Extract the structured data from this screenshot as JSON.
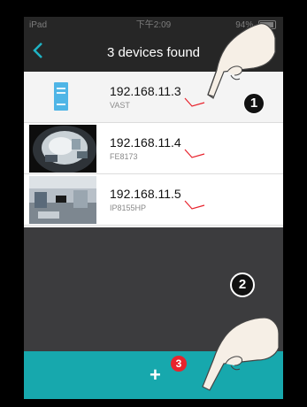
{
  "status_bar": {
    "device": "iPad",
    "time": "下午2:09",
    "battery": "94%"
  },
  "nav": {
    "title": "3 devices found"
  },
  "devices": [
    {
      "ip": "192.168.11.3",
      "model": "VAST"
    },
    {
      "ip": "192.168.11.4",
      "model": "FE8173"
    },
    {
      "ip": "192.168.11.5",
      "model": "IP8155HP"
    }
  ],
  "add_bar": {
    "plus": "+"
  },
  "steps": {
    "one": "1",
    "two": "2",
    "three": "3"
  },
  "colors": {
    "accent": "#17a8ad",
    "back": "#1fb3c4",
    "tick": "#e8232d"
  },
  "icons": {
    "back": "chevron-left-icon",
    "server": "server-icon",
    "hand": "pointing-hand-icon",
    "add": "plus-icon"
  }
}
